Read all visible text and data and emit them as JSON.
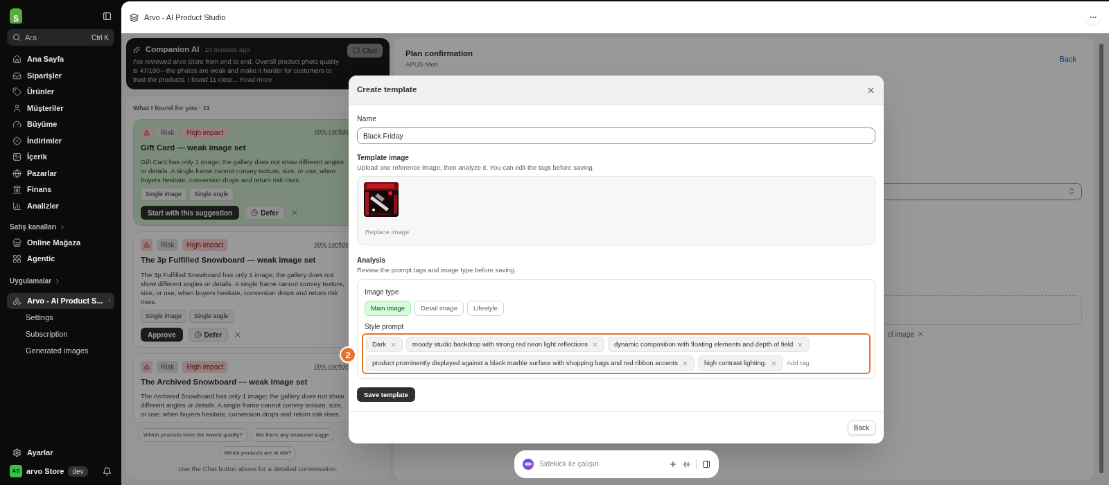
{
  "sidebar": {
    "logo": "S",
    "search": {
      "placeholder": "Ara",
      "shortcut": "Ctrl K"
    },
    "nav": [
      {
        "label": "Ana Sayfa",
        "selected": false
      },
      {
        "label": "Siparişler",
        "selected": false
      },
      {
        "label": "Ürünler",
        "selected": false
      },
      {
        "label": "Müşteriler",
        "selected": false
      },
      {
        "label": "Büyüme",
        "selected": false
      },
      {
        "label": "İndirimler",
        "selected": false
      },
      {
        "label": "İçerik",
        "selected": false
      },
      {
        "label": "Pazarlar",
        "selected": false
      },
      {
        "label": "Finans",
        "selected": false
      },
      {
        "label": "Analizler",
        "selected": false
      }
    ],
    "sales_channels": {
      "label": "Satış kanalları",
      "items": [
        {
          "label": "Online Mağaza",
          "selected": false
        },
        {
          "label": "Agentic",
          "selected": false
        }
      ]
    },
    "apps": {
      "label": "Uygulamalar",
      "items": [
        {
          "label": "Arvo - AI Product S...",
          "selected": true,
          "children": [
            {
              "label": "Settings",
              "selected": false
            },
            {
              "label": "Subscription",
              "selected": false
            },
            {
              "label": "Generated images",
              "selected": false
            }
          ]
        }
      ]
    },
    "settings": "Ayarlar",
    "store": {
      "initials": "AS",
      "name": "arvo Store",
      "badge": "dev"
    }
  },
  "top_bar": {
    "title": "Arvo - AI Product Studio"
  },
  "companion": {
    "title": "Companion AI",
    "time": "10 minutes ago",
    "text": "I've reviewed arvo Store from end to end. Overall product photo quality is 47/100—the photos are weak and make it harder for customers to trust the products. I found 11 clear...",
    "read_more": "Read more",
    "chat_button": "Chat"
  },
  "findings": {
    "heading": "What I found for you · 11",
    "cards": [
      {
        "highlighted": true,
        "category": "Risk",
        "impact": "High impact",
        "confidence": "80% confide",
        "title": "Gift Card — weak image set",
        "text": "Gift Card has only 1 image; the gallery does not show different angles or details. A single frame cannot convey texture, size, or use; when buyers hesitate, conversion drops and return risk rises.",
        "tags": [
          "Single image",
          "Single angle"
        ],
        "primary": "Start with this suggestion",
        "defer": "Defer"
      },
      {
        "highlighted": false,
        "category": "Risk",
        "impact": "High impact",
        "confidence": "80% confide",
        "title": "The 3p Fulfilled Snowboard — weak image set",
        "text": "The 3p Fulfilled Snowboard has only 1 image; the gallery does not show different angles or details. A single frame cannot convey texture, size, or use; when buyers hesitate, conversion drops and return risk rises.",
        "tags": [
          "Single image",
          "Single angle"
        ],
        "primary": "Approve",
        "defer": "Defer"
      },
      {
        "highlighted": false,
        "category": "Risk",
        "impact": "High impact",
        "confidence": "80% confide",
        "title": "The Archived Snowboard — weak image set",
        "text": "The Archived Snowboard has only 1 image; the gallery does not show different angles or details. A single frame cannot convey texture, size, or use; when buyers hesitate, conversion drops and return risk rises."
      }
    ],
    "chips": [
      "Which products have the lowest quality?",
      "Are there any seasonal sugge",
      "Which products are at risk?"
    ],
    "footer": "Use the Chat button above for a detailed conversation."
  },
  "plan": {
    "title": "Plan confirmation",
    "subtitle": "APUS Men",
    "back": "Back",
    "partial_text": "ct image"
  },
  "modal": {
    "title": "Create template",
    "name_label": "Name",
    "name_value": "Black Friday",
    "image_label": "Template image",
    "image_hint": "Upload one reference image, then analyze it. You can edit the tags before saving.",
    "replace": "Replace image",
    "analysis_label": "Analysis",
    "analysis_hint": "Review the prompt tags and image type before saving.",
    "image_type_label": "Image type",
    "image_types": [
      {
        "label": "Main image",
        "selected": true
      },
      {
        "label": "Detail image",
        "selected": false
      },
      {
        "label": "Lifestyle",
        "selected": false
      }
    ],
    "style_label": "Style prompt",
    "tags": [
      "Dark",
      "moody studio backdrop with strong red neon light reflections",
      "dynamic composition with floating elements and depth of field",
      "product prominently displayed against a black marble surface with shopping bags and red ribbon accents",
      "high contrast lighting."
    ],
    "tag_placeholder": "Add tag",
    "save": "Save template",
    "back": "Back"
  },
  "annotation": {
    "number": "2"
  },
  "sidekick": {
    "placeholder": "Sidekick ile çalışın"
  }
}
